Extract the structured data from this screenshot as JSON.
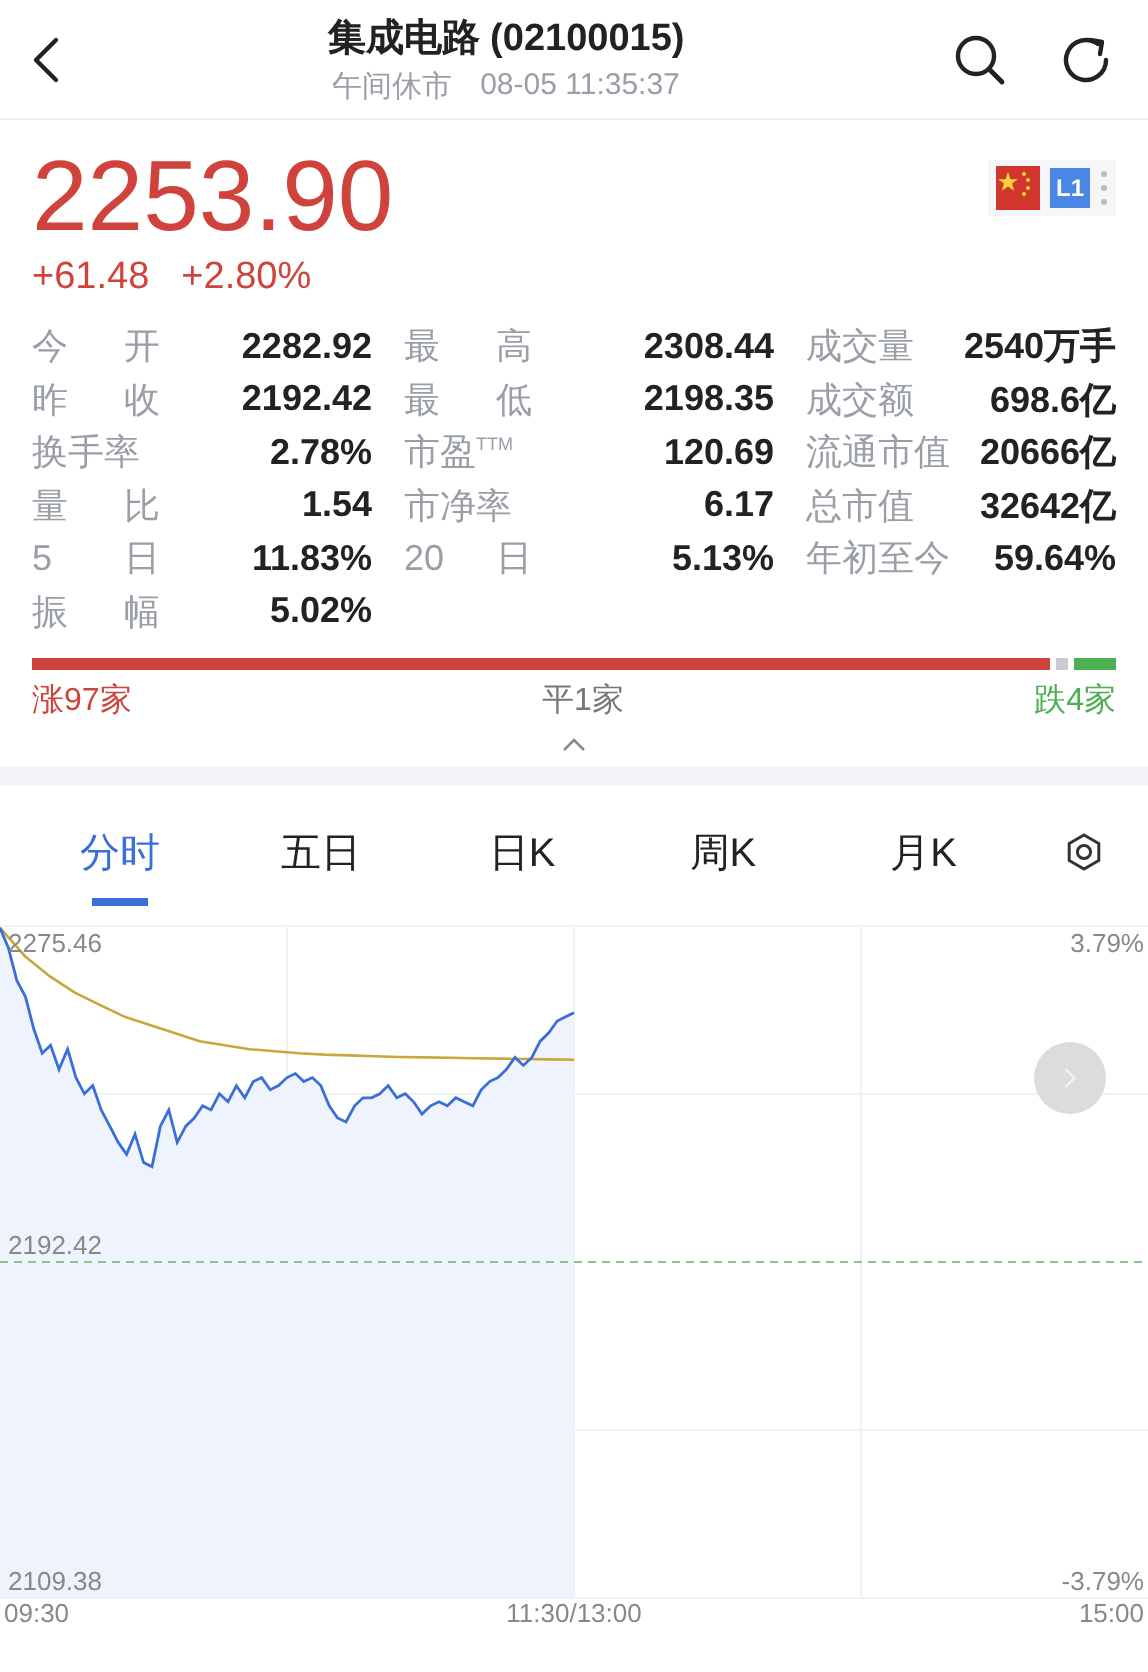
{
  "header": {
    "title": "集成电路 (02100015)",
    "status": "午间休市",
    "time": "08-05 11:35:37"
  },
  "quote": {
    "price": "2253.90",
    "change": "+61.48",
    "change_pct": "+2.80%",
    "badge": "L1"
  },
  "stats": [
    [
      {
        "label": "今 开",
        "value": "2282.92"
      },
      {
        "label": "昨 收",
        "value": "2192.42"
      },
      {
        "label": "换手率",
        "value": "2.78%"
      },
      {
        "label": "量 比",
        "value": "1.54"
      },
      {
        "label": "5 日",
        "value": "11.83%"
      },
      {
        "label": "振 幅",
        "value": "5.02%"
      }
    ],
    [
      {
        "label": "最 高",
        "value": "2308.44"
      },
      {
        "label": "最 低",
        "value": "2198.35"
      },
      {
        "label": "市盈$^{TTM}$",
        "value": "120.69"
      },
      {
        "label": "市净率",
        "value": "6.17"
      },
      {
        "label": "20 日",
        "value": "5.13%"
      }
    ],
    [
      {
        "label": "成交量",
        "value": "2540万手"
      },
      {
        "label": "成交额",
        "value": "698.6亿"
      },
      {
        "label": "流通市值",
        "value": "20666亿"
      },
      {
        "label": "总市值",
        "value": "32642亿"
      },
      {
        "label": "年初至今",
        "value": "59.64%"
      }
    ]
  ],
  "breadth": [
    {
      "kind": "up",
      "label": "涨97家"
    },
    {
      "kind": "flat",
      "label": "平1家"
    },
    {
      "kind": "down",
      "label": "跌4家"
    }
  ],
  "tabs": [
    {
      "label": "分时",
      "selected": true
    },
    {
      "label": "五日",
      "selected": false
    },
    {
      "label": "日K",
      "selected": false
    },
    {
      "label": "周K",
      "selected": false
    },
    {
      "label": "月K",
      "selected": false
    }
  ],
  "chart": {
    "y_labels": [
      "2275.46",
      "2192.42",
      "2109.38"
    ],
    "right_labels": [
      "3.79%",
      "-3.79%"
    ],
    "x_labels": [
      "09:30",
      "11:30/13:00",
      "15:00"
    ]
  }
}
